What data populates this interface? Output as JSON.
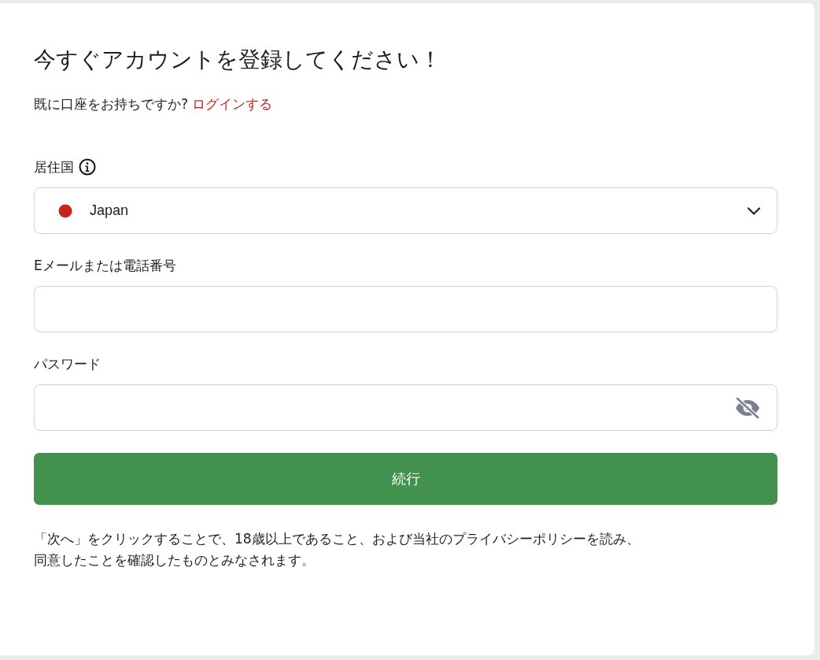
{
  "title": "今すぐアカウントを登録してください！",
  "login_prompt": {
    "question": "既に口座をお持ちですか?",
    "link": "ログインする"
  },
  "fields": [
    {
      "kind": "select",
      "label": "居住国",
      "info": true,
      "value": "Japan"
    },
    {
      "kind": "text",
      "label": "Eメールまたは電話番号"
    },
    {
      "kind": "password",
      "label": "パスワード",
      "masked": true
    }
  ],
  "submit_button": "続行",
  "disclaimer": "「次へ」をクリックすることで、18歳以上であること、および当社のプライバシーポリシーを読み、同意したことを確認したものとみなされます。"
}
